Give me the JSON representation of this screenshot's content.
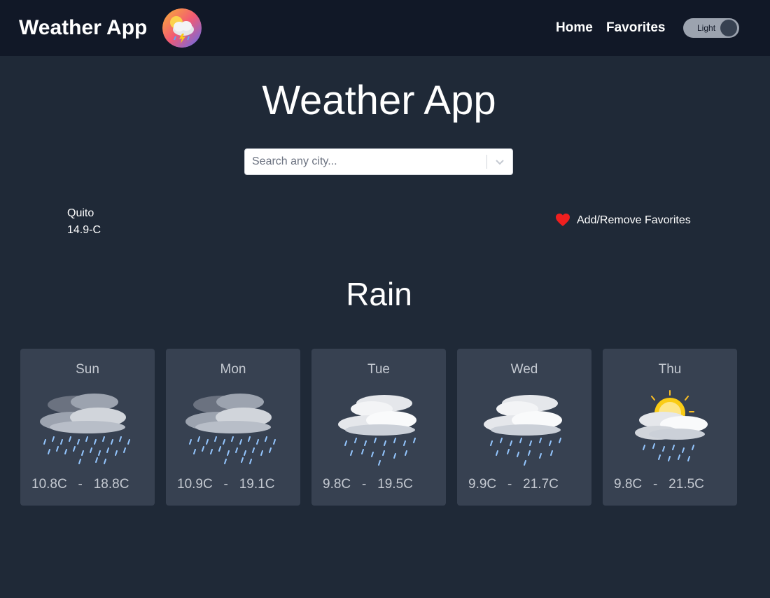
{
  "navbar": {
    "brand": "Weather App",
    "links": [
      "Home",
      "Favorites"
    ],
    "theme_toggle_label": "Light"
  },
  "main": {
    "title": "Weather App",
    "search": {
      "placeholder": "Search any city...",
      "value": ""
    },
    "current": {
      "city": "Quito",
      "temperature": "14.9-C",
      "favorites_action": "Add/Remove Favorites",
      "condition": "Rain"
    },
    "forecast": [
      {
        "day": "Sun",
        "min": "10.8C",
        "separator": "-",
        "max": "18.8C",
        "icon": "heavy-rain-icon"
      },
      {
        "day": "Mon",
        "min": "10.9C",
        "separator": "-",
        "max": "19.1C",
        "icon": "heavy-rain-icon"
      },
      {
        "day": "Tue",
        "min": "9.8C",
        "separator": "-",
        "max": "19.5C",
        "icon": "rain-icon"
      },
      {
        "day": "Wed",
        "min": "9.9C",
        "separator": "-",
        "max": "21.7C",
        "icon": "rain-icon"
      },
      {
        "day": "Thu",
        "min": "9.8C",
        "separator": "-",
        "max": "21.5C",
        "icon": "sun-rain-icon"
      }
    ]
  },
  "colors": {
    "background": "#1f2937",
    "navbar": "#111827",
    "card": "#374151",
    "heart": "#ef1f1f"
  }
}
